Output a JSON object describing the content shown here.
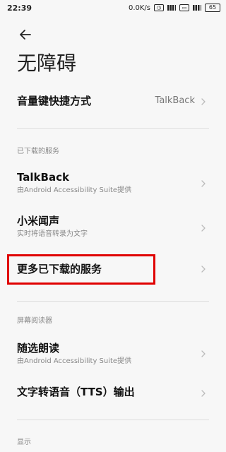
{
  "status_bar": {
    "time": "22:39",
    "network_speed": "0.0K/s",
    "battery": "65",
    "icons": [
      "alarm-icon",
      "signal-icon",
      "notification-icon",
      "battery-icon"
    ]
  },
  "header": {
    "back_icon": "back-arrow-icon",
    "title": "无障碍"
  },
  "volume_key_shortcut": {
    "label": "音量键快捷方式",
    "value": "TalkBack",
    "chevron": "chevron-right-icon"
  },
  "downloaded_services": {
    "header": "已下载的服务",
    "items": [
      {
        "title": "TalkBack",
        "subtitle": "由Android Accessibility Suite提供"
      },
      {
        "title": "小米闻声",
        "subtitle": "实时将语音转录为文字"
      },
      {
        "title": "更多已下载的服务",
        "subtitle": ""
      }
    ]
  },
  "screen_reader": {
    "header": "屏幕阅读器",
    "items": [
      {
        "title": "随选朗读",
        "subtitle": "由Android Accessibility Suite提供"
      },
      {
        "title": "文字转语音（TTS）输出",
        "subtitle": ""
      }
    ]
  },
  "display_section": {
    "header": "显示"
  },
  "annotation": {
    "highlight_color": "#e00000"
  }
}
